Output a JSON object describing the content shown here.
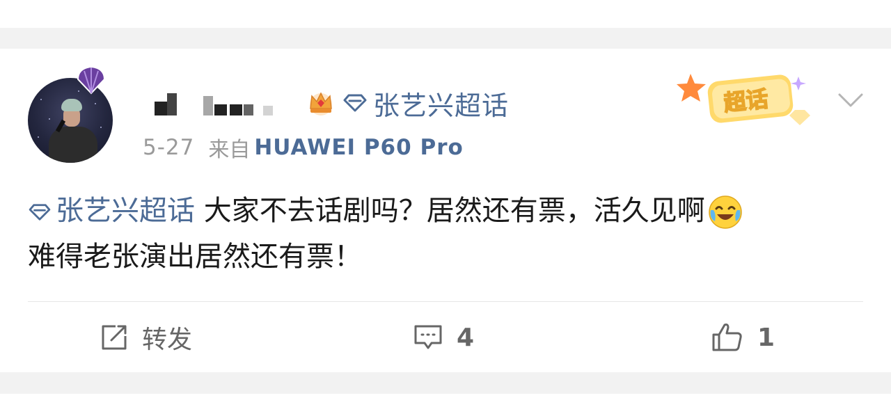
{
  "post": {
    "topic": "张艺兴超话",
    "date": "5-27",
    "source_prefix": "来自",
    "device": "HUAWEI P60 Pro",
    "badge_label": "超话",
    "text_line1": "大家不去话剧吗？居然还有票，活久见啊",
    "text_line2": "难得老张演出居然还有票！"
  },
  "actions": {
    "repost_label": "转发",
    "comment_count": "4",
    "like_count": "1"
  },
  "colors": {
    "link": "#4c6b96",
    "text": "#1a1a1a",
    "muted": "#9a9a9a",
    "page_bg": "#f2f2f2"
  },
  "icons": [
    "shell-badge-icon",
    "crown-icon",
    "diamond-icon",
    "chevron-down-icon",
    "laugh-cry-emoji-icon",
    "repost-icon",
    "comment-icon",
    "like-icon"
  ]
}
